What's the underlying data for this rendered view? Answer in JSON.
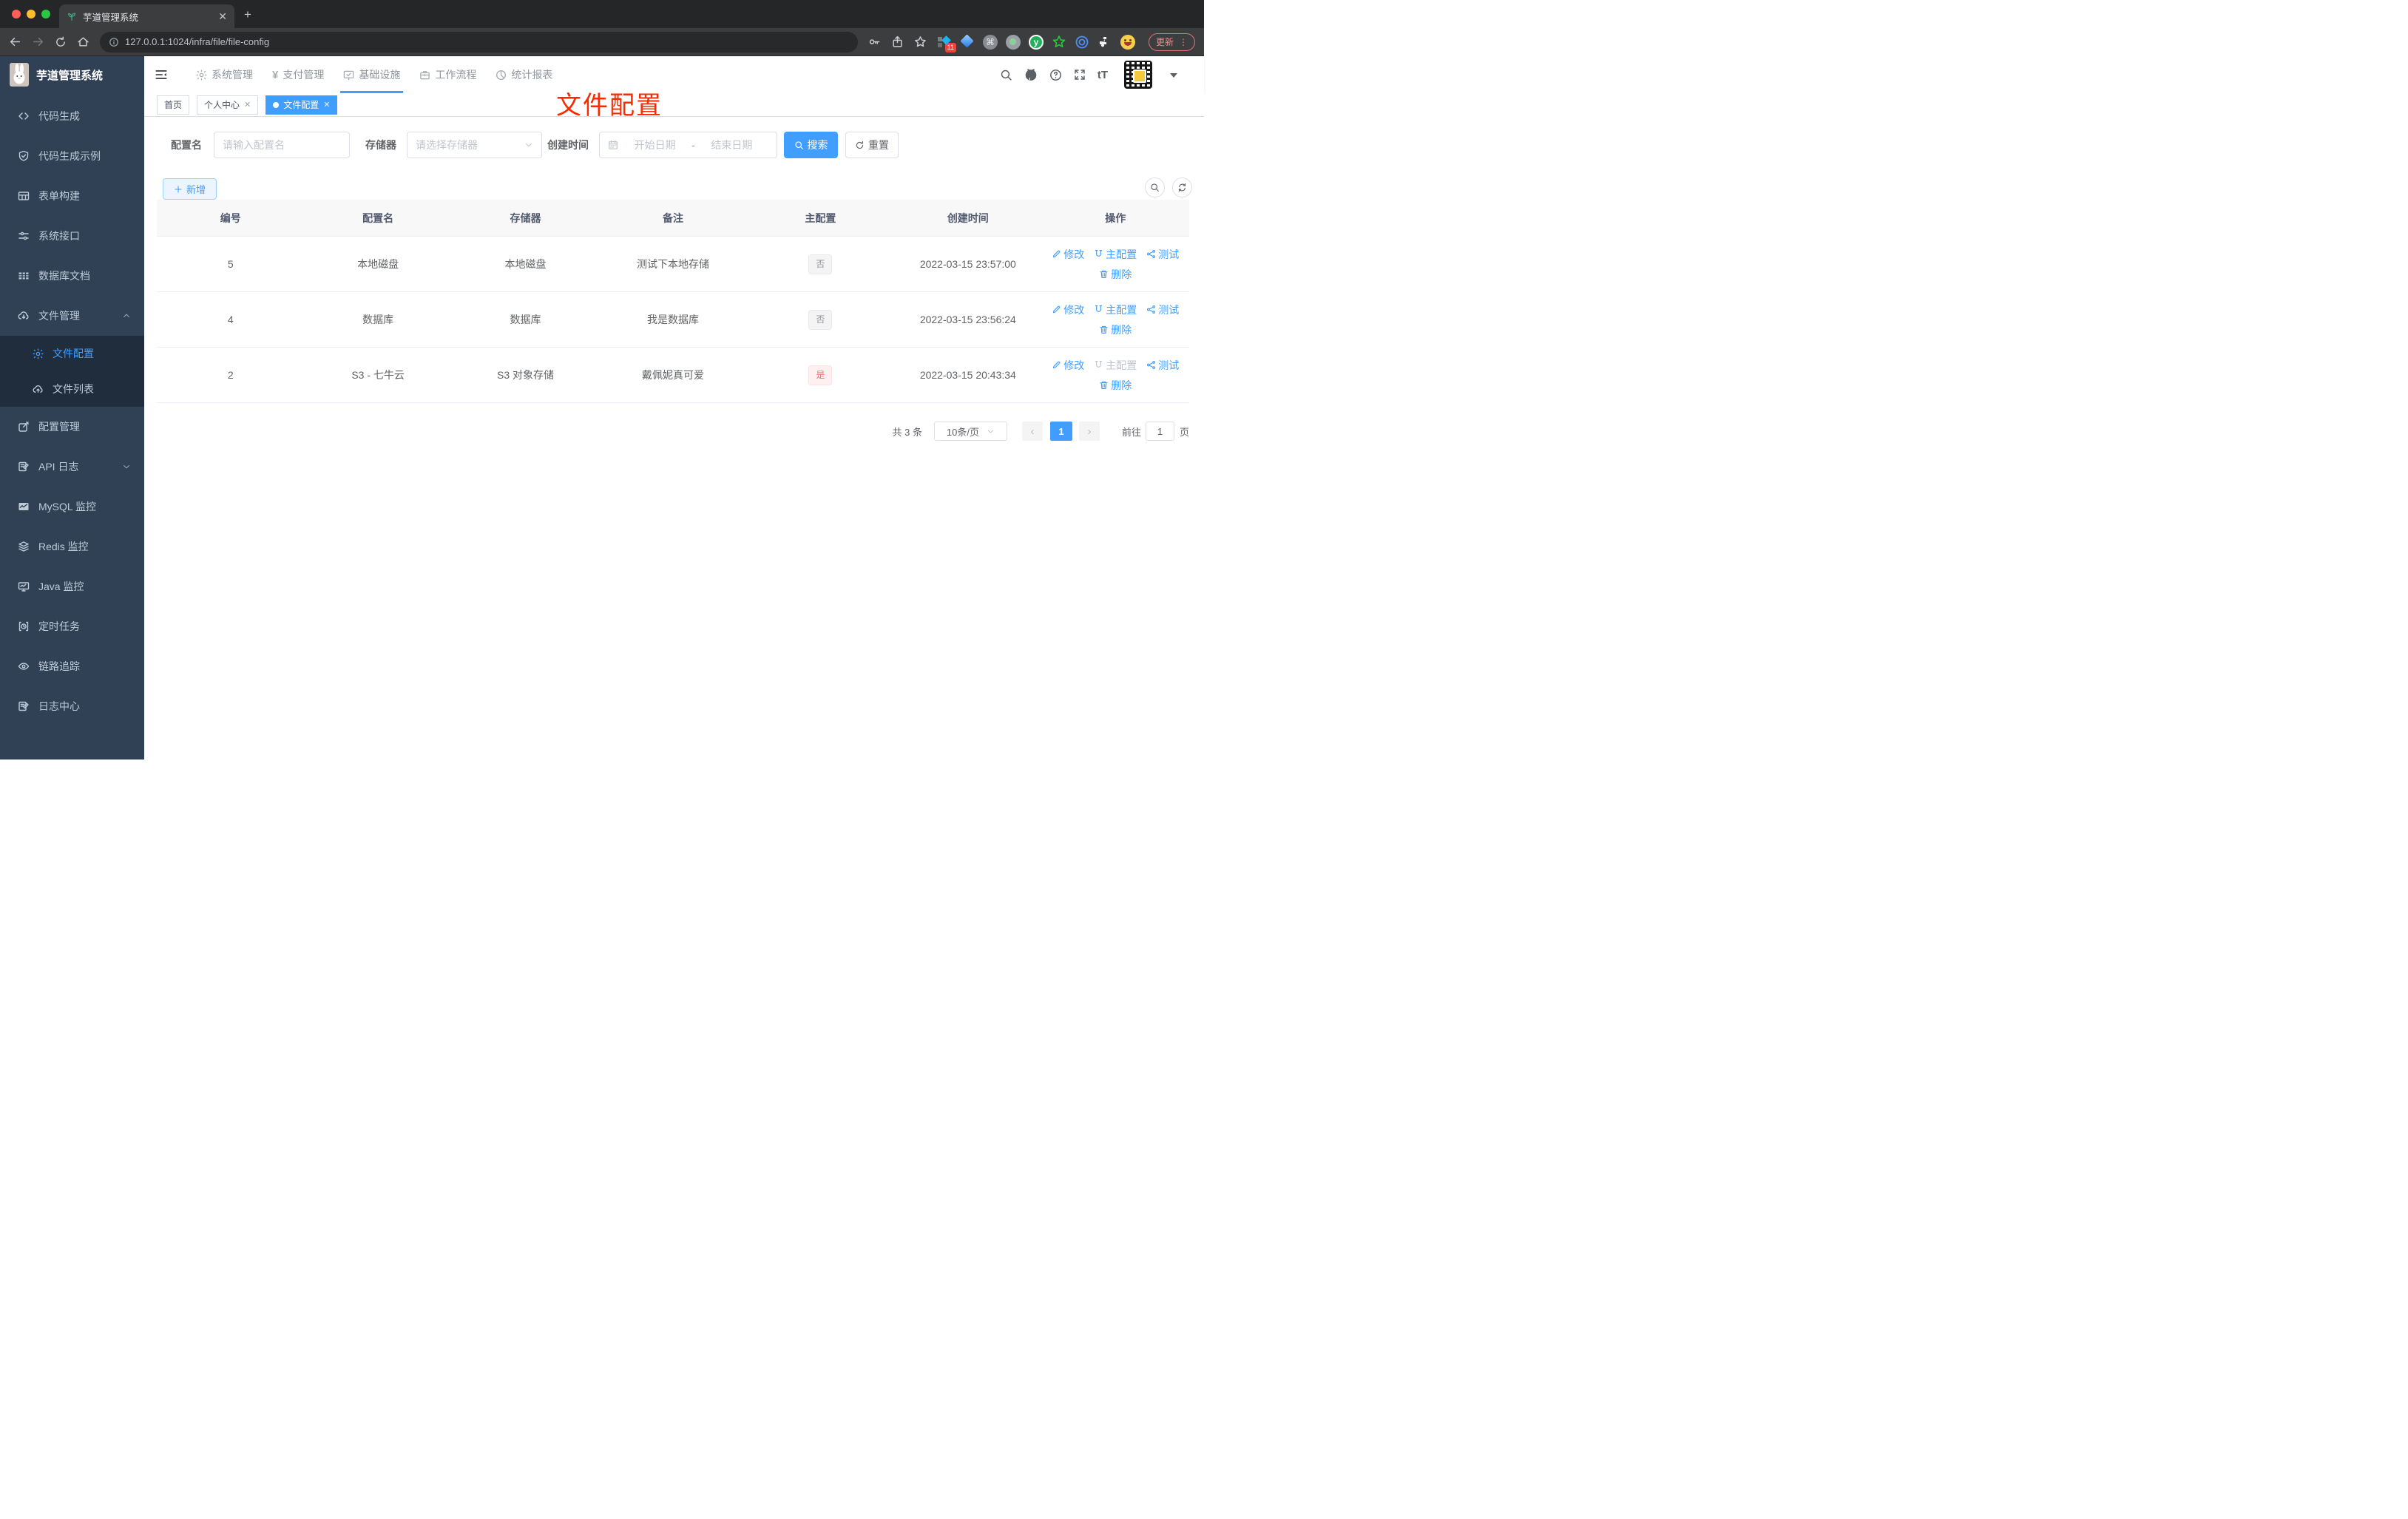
{
  "browser": {
    "tab_title": "芋道管理系统",
    "url": "127.0.0.1:1024/infra/file/file-config",
    "update_label": "更新",
    "extension_badge": "11",
    "kebab": "⋮"
  },
  "app": {
    "logo_title": "芋道管理系统",
    "nav": {
      "items": [
        {
          "label": "系统管理",
          "icon": "gear-icon"
        },
        {
          "label": "支付管理",
          "icon": "yen-icon"
        },
        {
          "label": "基础设施",
          "icon": "monitor-check-icon",
          "active": true
        },
        {
          "label": "工作流程",
          "icon": "briefcase-icon"
        },
        {
          "label": "统计报表",
          "icon": "pie-chart-icon"
        }
      ]
    },
    "tags": [
      {
        "label": "首页"
      },
      {
        "label": "个人中心",
        "closable": true
      },
      {
        "label": "文件配置",
        "closable": true,
        "active": true
      }
    ],
    "annotation": "文件配置",
    "sidebar": {
      "items": [
        {
          "label": "代码生成",
          "icon": "code-icon"
        },
        {
          "label": "代码生成示例",
          "icon": "shield-check-icon"
        },
        {
          "label": "表单构建",
          "icon": "form-grid-icon"
        },
        {
          "label": "系统接口",
          "icon": "sliders-icon"
        },
        {
          "label": "数据库文档",
          "icon": "database-table-icon"
        },
        {
          "label": "文件管理",
          "icon": "cloud-download-icon",
          "expanded": true
        },
        {
          "label": "配置管理",
          "icon": "edit-square-icon"
        },
        {
          "label": "API 日志",
          "icon": "log-icon",
          "collapsed": true
        },
        {
          "label": "MySQL 监控",
          "icon": "chart-icon"
        },
        {
          "label": "Redis 监控",
          "icon": "layers-icon"
        },
        {
          "label": "Java 监控",
          "icon": "java-monitor-icon"
        },
        {
          "label": "定时任务",
          "icon": "timer-icon"
        },
        {
          "label": "链路追踪",
          "icon": "eye-icon"
        },
        {
          "label": "日志中心",
          "icon": "log-icon"
        }
      ],
      "submenu": [
        {
          "label": "文件配置",
          "icon": "gear-icon",
          "active": true
        },
        {
          "label": "文件列表",
          "icon": "cloud-upload-icon"
        }
      ]
    }
  },
  "filter": {
    "name_label": "配置名",
    "name_placeholder": "请输入配置名",
    "storage_label": "存储器",
    "storage_placeholder": "请选择存储器",
    "date_label": "创建时间",
    "date_start_placeholder": "开始日期",
    "date_separator": "-",
    "date_end_placeholder": "结束日期",
    "search_label": "搜索",
    "reset_label": "重置",
    "add_label": "新增"
  },
  "table": {
    "columns": [
      "编号",
      "配置名",
      "存储器",
      "备注",
      "主配置",
      "创建时间",
      "操作"
    ],
    "actions": {
      "edit": "修改",
      "master": "主配置",
      "test": "测试",
      "delete": "删除"
    },
    "rows": [
      {
        "id": "5",
        "name": "本地磁盘",
        "storage": "本地磁盘",
        "remark": "测试下本地存储",
        "primary": "否",
        "primary_type": "info",
        "created": "2022-03-15 23:57:00",
        "master_disabled": false
      },
      {
        "id": "4",
        "name": "数据库",
        "storage": "数据库",
        "remark": "我是数据库",
        "primary": "否",
        "primary_type": "info",
        "created": "2022-03-15 23:56:24",
        "master_disabled": false
      },
      {
        "id": "2",
        "name": "S3 - 七牛云",
        "storage": "S3 对象存储",
        "remark": "戴佩妮真可爱",
        "primary": "是",
        "primary_type": "danger",
        "created": "2022-03-15 20:43:34",
        "master_disabled": true
      }
    ]
  },
  "pagination": {
    "total": "共 3 条",
    "page_size": "10条/页",
    "prev": "‹",
    "next": "›",
    "current_page": "1",
    "goto_label": "前往",
    "goto_value": "1",
    "unit_label": "页"
  },
  "colors": {
    "accent": "#409eff",
    "danger": "#f56c6c",
    "sidebar_bg": "#304156",
    "submenu_bg": "#1f2d3d",
    "annotation_red": "#f62c00",
    "active_tag_bg": "#409eff"
  }
}
